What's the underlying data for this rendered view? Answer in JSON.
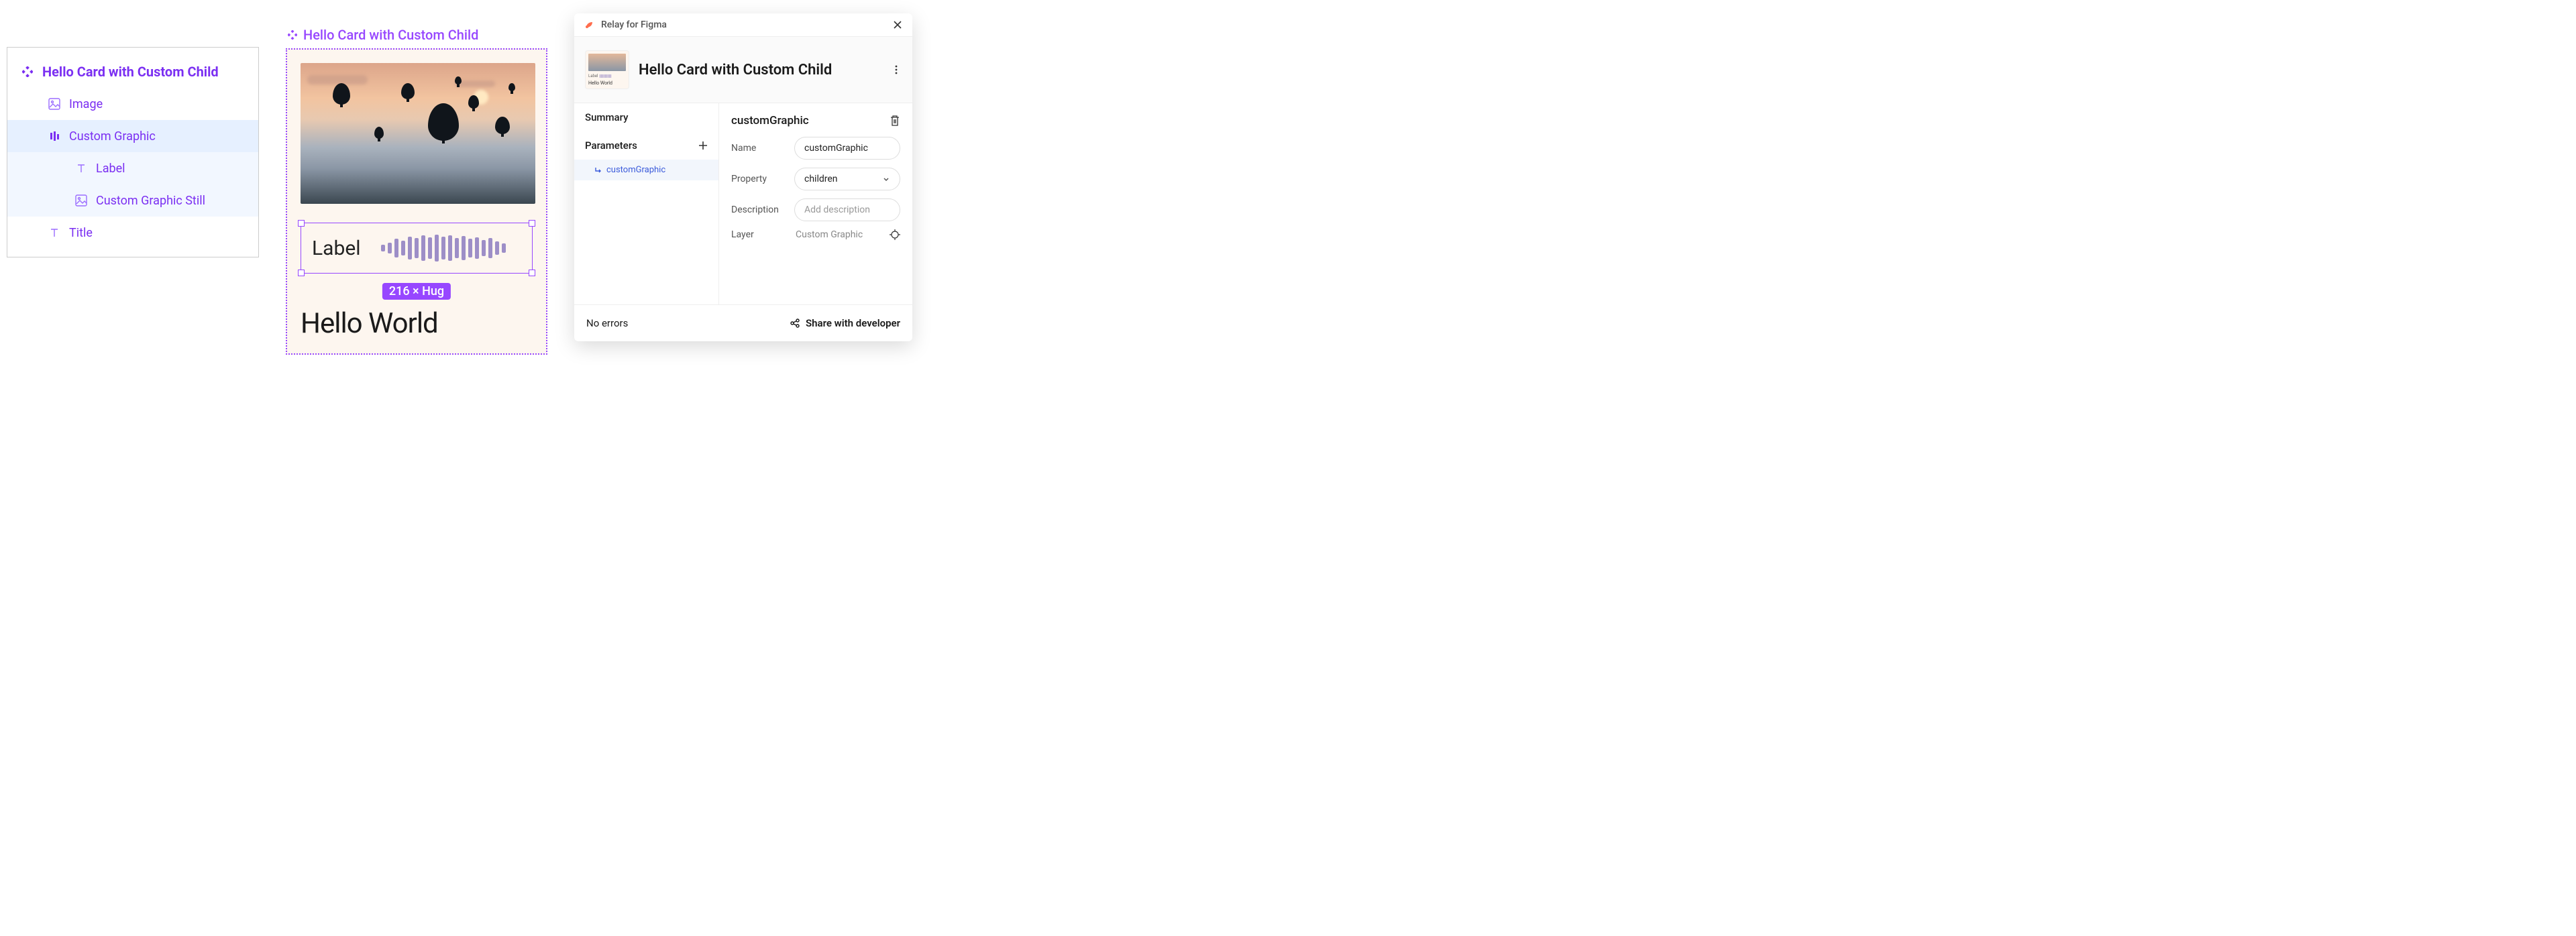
{
  "layers": {
    "component_name": "Hello Card with Custom Child",
    "items": [
      {
        "label": "Image"
      },
      {
        "label": "Custom Graphic"
      },
      {
        "label": "Label"
      },
      {
        "label": "Custom Graphic Still"
      },
      {
        "label": "Title"
      }
    ]
  },
  "canvas": {
    "frame_label": "Hello Card with Custom Child",
    "graphic_label": "Label",
    "size_badge": "216 × Hug",
    "title_text": "Hello World"
  },
  "plugin": {
    "app_name": "Relay for Figma",
    "component_title": "Hello Card with Custom Child",
    "thumb": {
      "label": "Label",
      "title": "Hello World"
    },
    "sidebar": {
      "summary": "Summary",
      "parameters": "Parameters",
      "param_item": "customGraphic"
    },
    "form": {
      "title": "customGraphic",
      "name_label": "Name",
      "name_value": "customGraphic",
      "property_label": "Property",
      "property_value": "children",
      "description_label": "Description",
      "description_placeholder": "Add description",
      "layer_label": "Layer",
      "layer_value": "Custom Graphic"
    },
    "footer": {
      "status": "No errors",
      "share": "Share with developer"
    }
  }
}
